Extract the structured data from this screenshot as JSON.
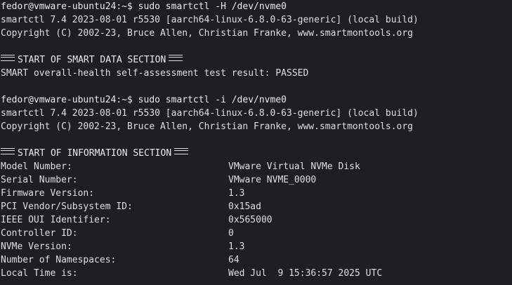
{
  "blocks": [
    {
      "prompt": "fedor@vmware-ubuntu24:~$ sudo smartctl -H /dev/nvme0",
      "version_line": "smartctl 7.4 2023-08-01 r5530 [aarch64-linux-6.8.0-63-generic] (local build)",
      "copyright_line": "Copyright (C) 2002-23, Bruce Allen, Christian Franke, www.smartmontools.org",
      "section_title": "START OF SMART DATA SECTION",
      "result_line": "SMART overall-health self-assessment test result: PASSED"
    },
    {
      "prompt": "fedor@vmware-ubuntu24:~$ sudo smartctl -i /dev/nvme0",
      "version_line": "smartctl 7.4 2023-08-01 r5530 [aarch64-linux-6.8.0-63-generic] (local build)",
      "copyright_line": "Copyright (C) 2002-23, Bruce Allen, Christian Franke, www.smartmontools.org",
      "section_title": "START OF INFORMATION SECTION"
    }
  ],
  "info": [
    {
      "key": "Model Number:",
      "value": "VMware Virtual NVMe Disk"
    },
    {
      "key": "Serial Number:",
      "value": "VMware NVME_0000"
    },
    {
      "key": "Firmware Version:",
      "value": "1.3"
    },
    {
      "key": "PCI Vendor/Subsystem ID:",
      "value": "0x15ad"
    },
    {
      "key": "IEEE OUI Identifier:",
      "value": "0x565000"
    },
    {
      "key": "Controller ID:",
      "value": "0"
    },
    {
      "key": "NVMe Version:",
      "value": "1.3"
    },
    {
      "key": "Number of Namespaces:",
      "value": "64"
    },
    {
      "key": "Local Time is:",
      "value": "Wed Jul  9 15:36:57 2025 UTC"
    }
  ],
  "colors": {
    "background": "#1e1f25",
    "foreground": "#dcdfe4"
  }
}
